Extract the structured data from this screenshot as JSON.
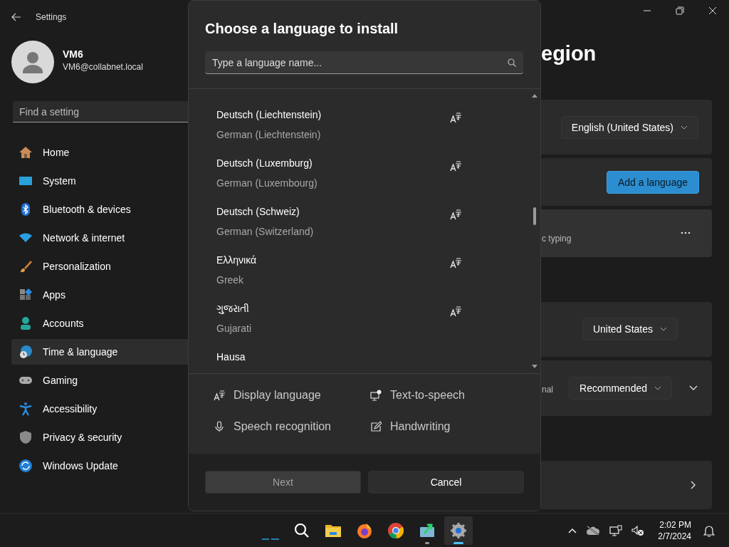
{
  "window": {
    "title": "Settings"
  },
  "account": {
    "name": "VM6",
    "email": "VM6@collabnet.local"
  },
  "search": {
    "placeholder": "Find a setting"
  },
  "nav": [
    {
      "label": "Home",
      "kind": "home",
      "selected": false
    },
    {
      "label": "System",
      "kind": "system",
      "selected": false
    },
    {
      "label": "Bluetooth & devices",
      "kind": "bluetooth",
      "selected": false
    },
    {
      "label": "Network & internet",
      "kind": "network",
      "selected": false
    },
    {
      "label": "Personalization",
      "kind": "brush",
      "selected": false
    },
    {
      "label": "Apps",
      "kind": "apps",
      "selected": false
    },
    {
      "label": "Accounts",
      "kind": "accounts",
      "selected": false
    },
    {
      "label": "Time & language",
      "kind": "time",
      "selected": true
    },
    {
      "label": "Gaming",
      "kind": "gaming",
      "selected": false
    },
    {
      "label": "Accessibility",
      "kind": "accessibility",
      "selected": false
    },
    {
      "label": "Privacy & security",
      "kind": "privacy",
      "selected": false
    },
    {
      "label": "Windows Update",
      "kind": "update",
      "selected": false
    }
  ],
  "page": {
    "title": "egion",
    "cards": [
      {
        "kind": "dropdown",
        "value": "English (United States)"
      },
      {
        "kind": "button",
        "label": "Add a language"
      },
      {
        "kind": "more",
        "text": "c typing"
      },
      {
        "kind": "dropdown",
        "value": "United States"
      },
      {
        "kind": "expand",
        "text": "nal",
        "value": "Recommended"
      },
      {
        "kind": "link"
      }
    ]
  },
  "dialog": {
    "title": "Choose a language to install",
    "search": {
      "placeholder": "Type a language name..."
    },
    "languages": [
      {
        "name": "Deutsch (Liechtenstein)",
        "english": "German (Liechtenstein)",
        "display_language": true
      },
      {
        "name": "Deutsch (Luxemburg)",
        "english": "German (Luxembourg)",
        "display_language": true
      },
      {
        "name": "Deutsch (Schweiz)",
        "english": "German (Switzerland)",
        "display_language": true
      },
      {
        "name": "Ελληνικά",
        "english": "Greek",
        "display_language": true
      },
      {
        "name": "ગુજરાતી",
        "english": "Gujarati",
        "display_language": true
      },
      {
        "name": "Hausa",
        "display_language": false
      }
    ],
    "features": [
      {
        "label": "Display language",
        "kind": "display"
      },
      {
        "label": "Text-to-speech",
        "kind": "speech"
      },
      {
        "label": "Speech recognition",
        "kind": "mic"
      },
      {
        "label": "Handwriting",
        "kind": "handwriting"
      }
    ],
    "buttons": [
      {
        "label": "Next",
        "disabled": true
      },
      {
        "label": "Cancel",
        "disabled": false
      }
    ]
  },
  "taskbar": {
    "apps": [
      {
        "kind": "widgets",
        "selected": false,
        "running": false
      },
      {
        "kind": "search",
        "selected": false,
        "running": false
      },
      {
        "kind": "folder",
        "selected": false,
        "running": false
      },
      {
        "kind": "firefox",
        "selected": false,
        "running": false
      },
      {
        "kind": "chrome",
        "selected": false,
        "running": false
      },
      {
        "kind": "app",
        "selected": false,
        "running": true
      },
      {
        "kind": "settings",
        "selected": true,
        "running": true
      }
    ],
    "clock": {
      "time": "2:02 PM",
      "date": "2/7/2024"
    }
  }
}
